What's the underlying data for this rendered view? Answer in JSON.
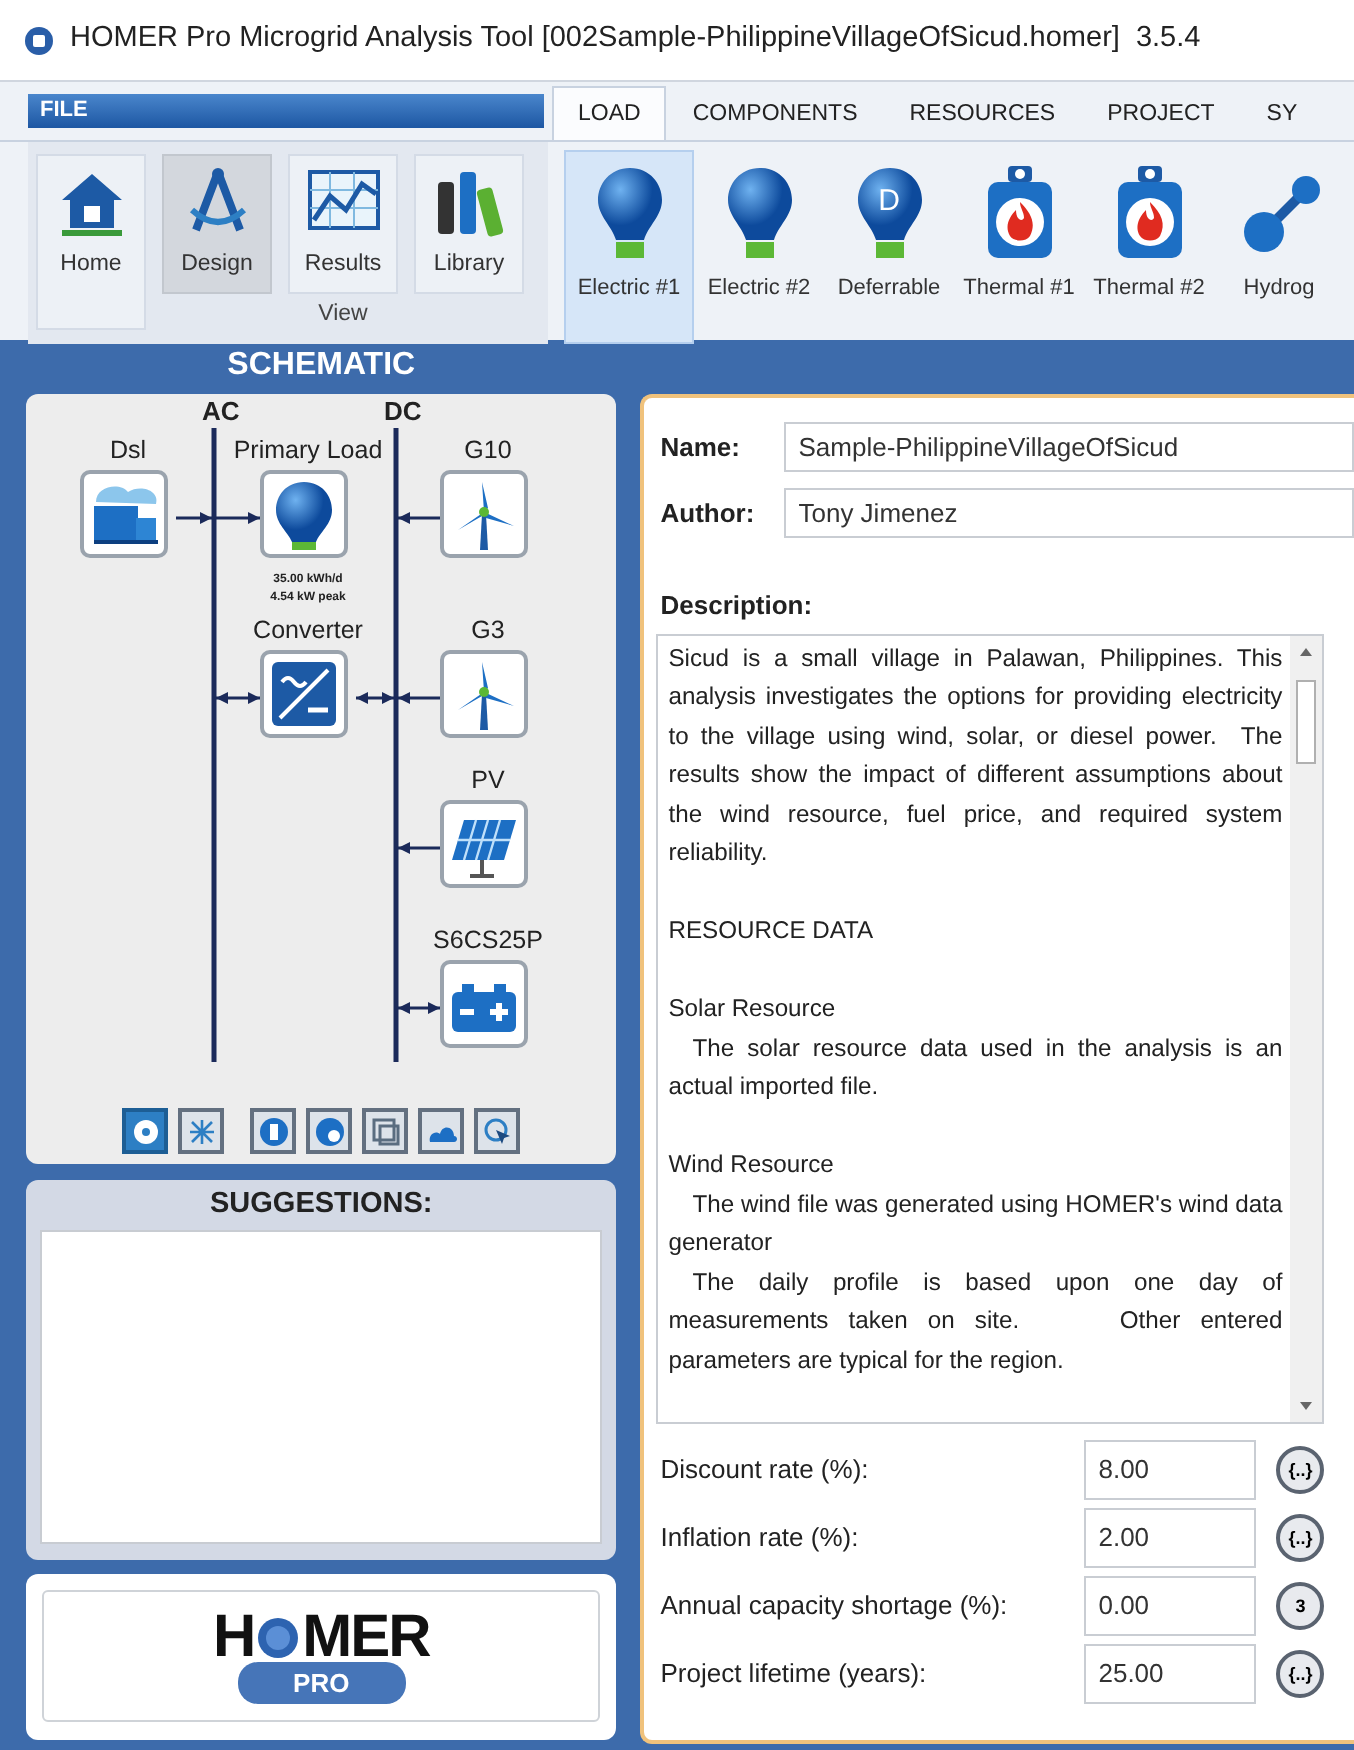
{
  "window": {
    "title": "HOMER Pro Microgrid Analysis Tool [002Sample-PhilippineVillageOfSicud.homer]",
    "version": "3.5.4"
  },
  "ribbon": {
    "file_tab": "FILE",
    "tabs": [
      {
        "label": "LOAD",
        "selected": true
      },
      {
        "label": "COMPONENTS",
        "selected": false
      },
      {
        "label": "RESOURCES",
        "selected": false
      },
      {
        "label": "PROJECT",
        "selected": false
      },
      {
        "label": "SY",
        "selected": false
      }
    ],
    "home_button": {
      "label": "Home"
    },
    "view_group": {
      "label": "View",
      "buttons": [
        {
          "label": "Design",
          "kind": "design",
          "selected": true
        },
        {
          "label": "Results",
          "kind": "results",
          "selected": false
        },
        {
          "label": "Library",
          "kind": "library",
          "selected": false
        }
      ]
    },
    "load_items": [
      {
        "label": "Electric #1",
        "kind": "bulb",
        "selected": true
      },
      {
        "label": "Electric #2",
        "kind": "bulb",
        "selected": false
      },
      {
        "label": "Deferrable",
        "kind": "deferrable",
        "icon_letter": "D",
        "selected": false
      },
      {
        "label": "Thermal #1",
        "kind": "thermal",
        "selected": false
      },
      {
        "label": "Thermal #2",
        "kind": "thermal",
        "selected": false
      },
      {
        "label": "Hydrog",
        "kind": "hydrogen",
        "selected": false
      }
    ]
  },
  "schematic": {
    "title": "SCHEMATIC",
    "buses": [
      {
        "label": "AC"
      },
      {
        "label": "DC"
      }
    ],
    "components": [
      {
        "label": "Dsl",
        "kind": "generator",
        "head_at_bus": true,
        "head_at_node": false
      },
      {
        "label": "Primary Load",
        "kind": "load",
        "head_at_bus": false,
        "head_at_node": true,
        "notes": [
          "35.00 kWh/d",
          "4.54 kW peak"
        ]
      },
      {
        "label": "G10",
        "kind": "wind",
        "head_at_bus": true,
        "head_at_node": false
      },
      {
        "label": "Converter",
        "kind": "converter",
        "head_at_bus": true,
        "head_at_node": true
      },
      {
        "label": "G3",
        "kind": "wind",
        "head_at_bus": true,
        "head_at_node": false
      },
      {
        "label": "PV",
        "kind": "pv",
        "head_at_bus": true,
        "head_at_node": false
      },
      {
        "label": "S6CS25P",
        "kind": "battery",
        "head_at_bus": true,
        "head_at_node": true
      }
    ],
    "toolbar": [
      {
        "kind": "system",
        "selected": true
      },
      {
        "kind": "sensitivity",
        "selected": false
      },
      {
        "kind": "economics",
        "selected": false
      },
      {
        "kind": "optimization",
        "selected": false
      },
      {
        "kind": "constraints",
        "selected": false
      },
      {
        "kind": "cloud",
        "selected": false
      },
      {
        "kind": "pointer",
        "selected": false
      }
    ]
  },
  "suggestions": {
    "title": "SUGGESTIONS:"
  },
  "logo": {
    "left": "H",
    "right": "MER",
    "badge": "PRO"
  },
  "project": {
    "name": {
      "label": "Name:",
      "value": "Sample-PhilippineVillageOfSicud"
    },
    "author": {
      "label": "Author:",
      "value": "Tony Jimenez"
    },
    "description": {
      "label": "Description:",
      "blocks": [
        {
          "lines": [
            "Sicud is a small village in Palawan, Philippines. This analysis investigates the options for providing electricity to the village using wind, solar, or diesel power.  The results show the impact of different assumptions about the wind resource, fuel price, and required system reliability."
          ]
        },
        {
          "lines": [
            "RESOURCE DATA"
          ]
        },
        {
          "heading": "Solar Resource",
          "lines": [
            "The solar resource data used in the analysis is an actual imported file."
          ]
        },
        {
          "heading": "Wind Resource",
          "lines": [
            "The wind file was generated using HOMER's wind data generator",
            "The daily profile is based upon one day of measurements taken on site.     Other entered parameters are typical for the region."
          ]
        }
      ]
    },
    "parameters": [
      {
        "label": "Discount rate (%):",
        "value": "8.00",
        "button": "{..}"
      },
      {
        "label": "Inflation rate (%):",
        "value": "2.00",
        "button": "{..}"
      },
      {
        "label": "Annual capacity shortage (%):",
        "value": "0.00",
        "button": "3"
      },
      {
        "label": "Project lifetime (years):",
        "value": "25.00",
        "button": "{..}"
      }
    ]
  }
}
